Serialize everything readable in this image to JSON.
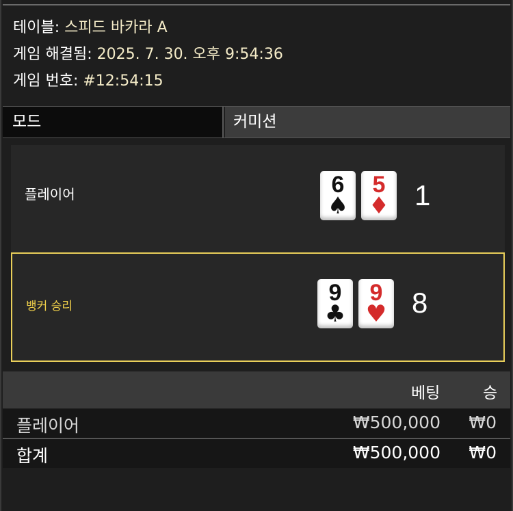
{
  "info": {
    "table_label": "테이블: ",
    "table_value": "스피드 바카라 A",
    "resolved_label": "게임 해결됨: ",
    "resolved_value": "2025. 7. 30. 오후 9:54:36",
    "game_no_label": "게임 번호: ",
    "game_no_value": "#12:54:15"
  },
  "mode": {
    "label": "모드",
    "value": "커미션"
  },
  "player": {
    "name": "플레이어",
    "cards": [
      {
        "rank": "6",
        "suit": "♠",
        "color": "#111111"
      },
      {
        "rank": "5",
        "suit": "♦",
        "color": "#d42b2b"
      }
    ],
    "total": "1"
  },
  "banker": {
    "name": "뱅커 승리",
    "highlight_color": "#e9cf5a",
    "cards": [
      {
        "rank": "9",
        "suit": "♣",
        "color": "#111111"
      },
      {
        "rank": "9",
        "suit": "♥",
        "color": "#d42b2b"
      }
    ],
    "total": "8"
  },
  "bets": {
    "columns": {
      "bet": "베팅",
      "win": "승"
    },
    "rows": [
      {
        "name": "플레이어",
        "bet": "₩500,000",
        "win": "₩0"
      }
    ],
    "total": {
      "name": "합계",
      "bet": "₩500,000",
      "win": "₩0"
    }
  }
}
